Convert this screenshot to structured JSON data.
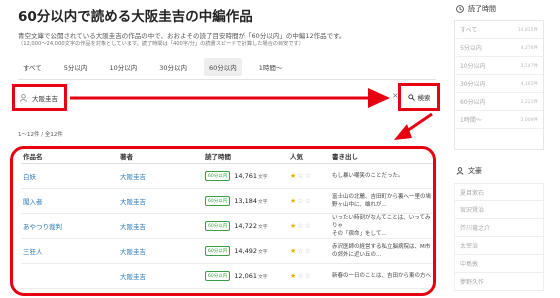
{
  "page": {
    "title": "60分以内で読める大阪圭吉の中編作品",
    "desc_line1": "青空文庫で公開されている大阪圭吉の作品の中で、おおよその読了目安時間が「60分以内」の中編12作品です。",
    "desc_line2": "（12,000〜24,000文字の作品を対象としています。読了時間は「400字/分」の読書スピードで計算した場合の目安です）"
  },
  "tabs": [
    "すべて",
    "5分以内",
    "10分以内",
    "30分以内",
    "60分以内",
    "1時間〜"
  ],
  "active_tab": "60分以内",
  "search": {
    "value": "大阪圭吉",
    "clear_label": "×",
    "button_label": "検索"
  },
  "result_count": "1〜12件 / 全12件",
  "table": {
    "headers": [
      "作品名",
      "著者",
      "読了時間",
      "人気",
      "書き出し"
    ],
    "rows": [
      {
        "title": "白妖",
        "author": "大阪圭吉",
        "time": "60分以内",
        "chars": "14,761",
        "unit": "文字",
        "stars": 1,
        "excerpt": [
          "もし暴い嘲笑のことだった。"
        ]
      },
      {
        "title": "闖入者",
        "author": "大阪圭吉",
        "time": "60分以内",
        "chars": "13,184",
        "unit": "文字",
        "stars": 1,
        "excerpt": [
          "富士山の北麓、吉田町から裏へ一里の鳩",
          "野ヶ山中に、雄れが..."
        ]
      },
      {
        "title": "あやつり裁判",
        "author": "大阪圭吉",
        "time": "60分以内",
        "chars": "14,722",
        "unit": "文字",
        "stars": 1,
        "excerpt": [
          "いったい時刻がなんてことは、いってみりゃ",
          "その「宿命」をして..."
        ]
      },
      {
        "title": "三狂人",
        "author": "大阪圭吉",
        "time": "60分以内",
        "chars": "14,492",
        "unit": "文字",
        "stars": 1,
        "excerpt": [
          "赤沢医師の経営する私立脳病院は、M市",
          "の郊外に近い丘の..."
        ]
      },
      {
        "title": "",
        "author": "大阪圭吉",
        "time": "60分以内",
        "chars": "12,061",
        "unit": "文字",
        "stars": 1,
        "excerpt": [
          "新春の一日のことは、吉田から東の方へ"
        ]
      }
    ]
  },
  "sidebar": {
    "time_title": "読了時間",
    "time_rows": [
      {
        "label": "すべて",
        "count": "14,815件"
      },
      {
        "label": "5分以内",
        "count": "4,276件"
      },
      {
        "label": "10分以内",
        "count": "2,147件"
      },
      {
        "label": "30分以内",
        "count": "4,162件"
      },
      {
        "label": "60分以内",
        "count": "2,221件"
      },
      {
        "label": "1時間〜",
        "count": "2,009件"
      }
    ],
    "authors_title": "文豪",
    "authors": [
      "夏目漱石",
      "宮沢賢治",
      "芥川竜之介",
      "太宰治",
      "中島敦",
      "夢野久作"
    ]
  },
  "colors": {
    "highlight": "#e60012",
    "link": "#2a7ab8",
    "badge": "#3a9e45",
    "star": "#e7b000"
  }
}
